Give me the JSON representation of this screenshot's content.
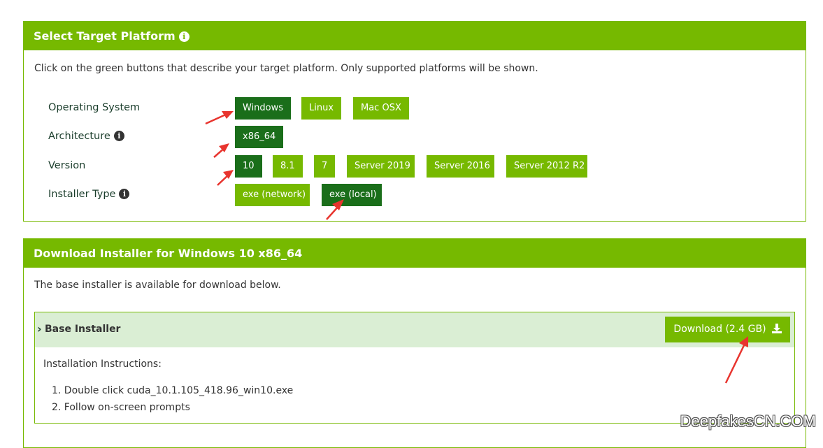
{
  "platform_panel": {
    "title": "Select Target Platform",
    "description": "Click on the green buttons that describe your target platform. Only supported platforms will be shown.",
    "rows": {
      "os": {
        "label": "Operating System",
        "options": [
          "Windows",
          "Linux",
          "Mac OSX"
        ],
        "selected": "Windows"
      },
      "arch": {
        "label": "Architecture",
        "options": [
          "x86_64"
        ],
        "selected": "x86_64"
      },
      "version": {
        "label": "Version",
        "options": [
          "10",
          "8.1",
          "7",
          "Server 2019",
          "Server 2016",
          "Server 2012 R2"
        ],
        "selected": "10"
      },
      "installer": {
        "label": "Installer Type",
        "options": [
          "exe (network)",
          "exe (local)"
        ],
        "selected": "exe (local)"
      }
    }
  },
  "download_panel": {
    "title": "Download Installer for Windows 10 x86_64",
    "description": "The base installer is available for download below.",
    "installer": {
      "title": "Base Installer",
      "download_label": "Download (2.4 GB)",
      "instructions_title": "Installation Instructions:",
      "steps": [
        "1. Double click cuda_10.1.105_418.96_win10.exe",
        "2. Follow on-screen prompts"
      ]
    }
  },
  "watermark": "DeepfakesCN.COM",
  "colors": {
    "accent": "#76b900",
    "selected": "#1a6e1a",
    "annotation": "#e8342e"
  }
}
